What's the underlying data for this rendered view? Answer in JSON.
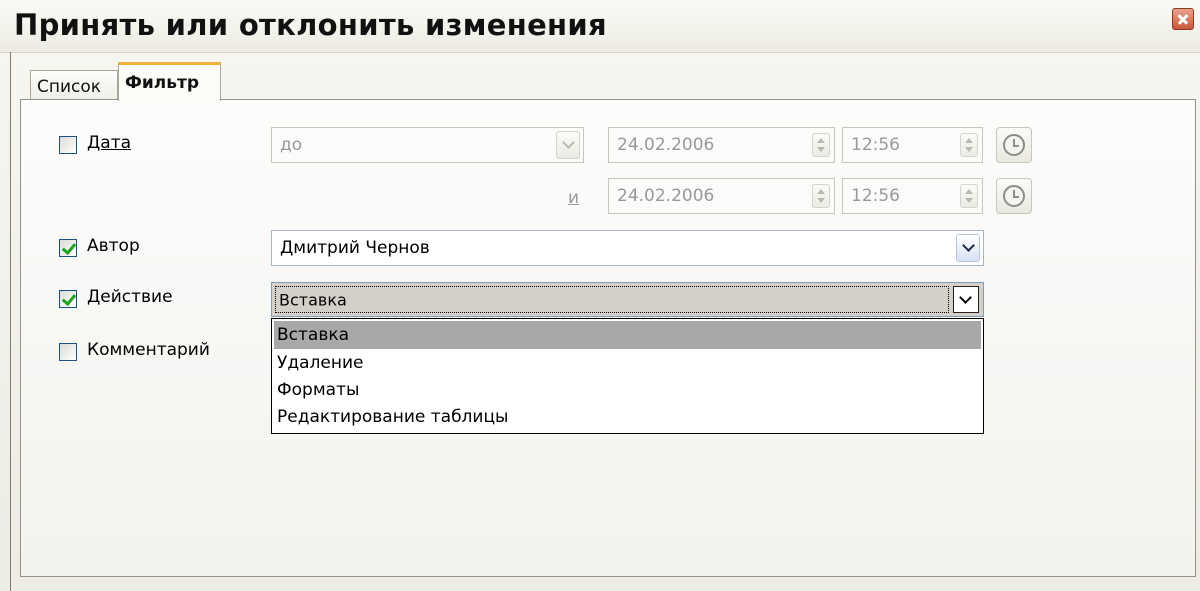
{
  "window": {
    "title": "Принять или отклонить изменения"
  },
  "tabs": [
    {
      "label": "Список",
      "active": false
    },
    {
      "label": "Фильтр",
      "active": true
    }
  ],
  "filter": {
    "date": {
      "label": "Дата",
      "checked": false,
      "condition": "до",
      "start_date": "24.02.2006",
      "start_time": "12:56",
      "and_label": "и",
      "end_date": "24.02.2006",
      "end_time": "12:56"
    },
    "author": {
      "label": "Автор",
      "checked": true,
      "value": "Дмитрий Чернов"
    },
    "action": {
      "label": "Действие",
      "checked": true,
      "value": "Вставка",
      "options": [
        "Вставка",
        "Удаление",
        "Форматы",
        "Редактирование таблицы"
      ],
      "selected_index": 0
    },
    "comment": {
      "label": "Комментарий",
      "checked": false
    }
  },
  "colors": {
    "tab_active_accent": "#f0b140",
    "checkmark": "#21a121",
    "selection": "#a8a8a8"
  }
}
